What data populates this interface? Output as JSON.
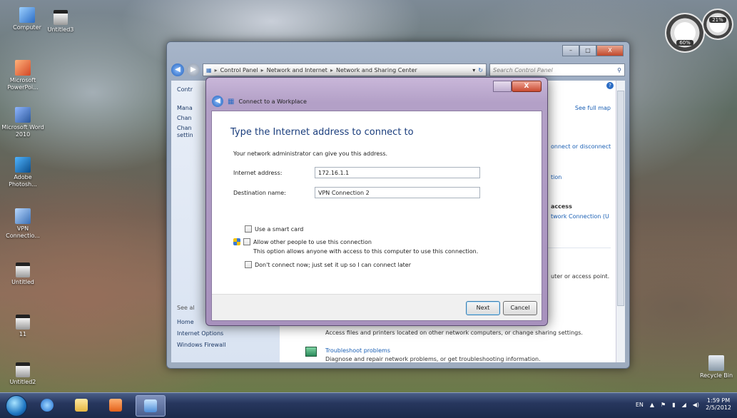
{
  "desktop": {
    "icons": [
      {
        "label": "Computer",
        "glyph": "computer-icon"
      },
      {
        "label": "Untitled3",
        "glyph": "file-icon"
      },
      {
        "label": "Microsoft PowerPoi...",
        "glyph": "powerpoint-icon"
      },
      {
        "label": "Microsoft Word 2010",
        "glyph": "word-icon"
      },
      {
        "label": "Adobe Photosh...",
        "glyph": "photoshop-icon"
      },
      {
        "label": "VPN Connectio...",
        "glyph": "vpn-icon"
      },
      {
        "label": "Untitled",
        "glyph": "file-icon"
      },
      {
        "label": "11",
        "glyph": "file-icon"
      },
      {
        "label": "Untitled2",
        "glyph": "file-icon"
      },
      {
        "label": "Recycle Bin",
        "glyph": "recycle-bin-icon"
      }
    ],
    "gadget": {
      "value1": "60%",
      "value2": "21%"
    }
  },
  "control_panel": {
    "breadcrumb": [
      "Control Panel",
      "Network and Internet",
      "Network and Sharing Center"
    ],
    "search_placeholder": "Search Control Panel",
    "left": {
      "top_item": "Contr",
      "items": [
        "Mana",
        "Chan",
        "Chan",
        "settin"
      ],
      "see_also": "See al",
      "bottom_items": [
        "Home",
        "Internet Options",
        "Windows Firewall"
      ]
    },
    "right": {
      "see_full_map": "See full map",
      "connect_disconnect": "onnect or disconnect",
      "tion": "tion",
      "access": "access",
      "network_connection": "twork Connection (U",
      "router_text": "uter or access point.",
      "access_files": "Access files and printers located on other network computers, or change sharing settings.",
      "troubleshoot": "Troubleshoot problems",
      "diagnose": "Diagnose and repair network problems, or get troubleshooting information."
    },
    "window_buttons": {
      "minimize": "–",
      "maximize": "□",
      "close": "X"
    }
  },
  "dialog": {
    "title": "Connect to a Workplace",
    "heading": "Type the Internet address to connect to",
    "subtitle": "Your network administrator can give you this address.",
    "internet_address_label": "Internet address:",
    "internet_address_value": "172.16.1.1",
    "destination_label": "Destination name:",
    "destination_value": "VPN Connection 2",
    "smart_card": "Use a smart card",
    "allow_others": "Allow other people to use this connection",
    "allow_desc": "This option allows anyone with access to this computer to use this connection.",
    "dont_connect": "Don't connect now; just set it up so I can connect later",
    "next_label": "Next",
    "cancel_label": "Cancel",
    "close_label": "X"
  },
  "taskbar": {
    "lang": "EN",
    "time": "1:59 PM",
    "date": "2/5/2012"
  }
}
